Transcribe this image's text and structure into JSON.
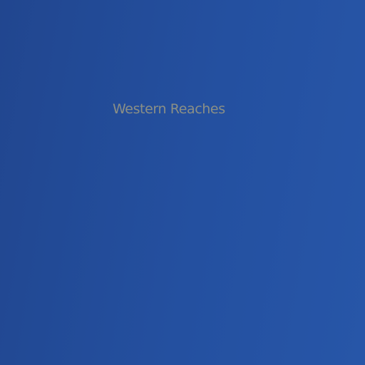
{
  "map": {
    "region_label": "Western Reaches",
    "colors": {
      "water_left": "#21468f",
      "water_right": "#2756a8",
      "label_text": "#8a8f86"
    }
  }
}
